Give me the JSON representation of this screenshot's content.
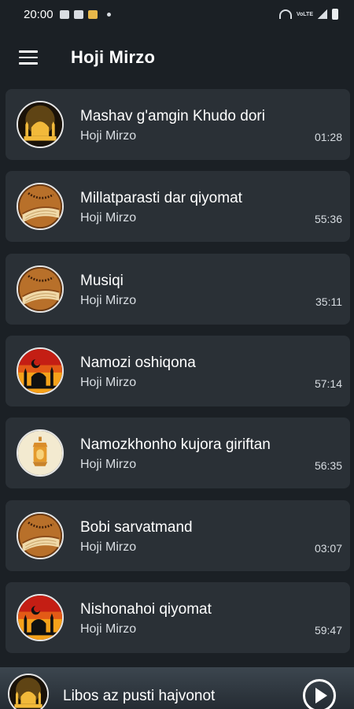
{
  "status_bar": {
    "time": "20:00",
    "lte": "VoLTE"
  },
  "app_bar": {
    "title": "Hoji Mirzo"
  },
  "tracks": [
    {
      "title": "Mashav g'amgin Khudo dori",
      "artist": "Hoji Mirzo",
      "duration": "01:28",
      "icon": "mosque-night-icon"
    },
    {
      "title": "Millatparasti dar qiyomat",
      "artist": "Hoji Mirzo",
      "duration": "55:36",
      "icon": "quran-rosary-icon"
    },
    {
      "title": "Musiqi",
      "artist": "Hoji Mirzo",
      "duration": "35:11",
      "icon": "quran-rosary-icon"
    },
    {
      "title": "Namozi oshiqona",
      "artist": "Hoji Mirzo",
      "duration": "57:14",
      "icon": "mosque-sunset-icon"
    },
    {
      "title": "Namozkhonho kujora giriftan",
      "artist": "Hoji Mirzo",
      "duration": "56:35",
      "icon": "lantern-icon"
    },
    {
      "title": "Bobi sarvatmand",
      "artist": "Hoji Mirzo",
      "duration": "03:07",
      "icon": "quran-rosary-icon"
    },
    {
      "title": "Nishonahoi qiyomat",
      "artist": "Hoji Mirzo",
      "duration": "59:47",
      "icon": "mosque-sunset-icon"
    }
  ],
  "player": {
    "title": "Libos az pusti hajvonot",
    "icon": "mosque-night-icon",
    "play_icon": "play-icon"
  },
  "colors": {
    "background": "#1b2025",
    "card": "#2a3036",
    "text_secondary": "#d8dde2"
  }
}
